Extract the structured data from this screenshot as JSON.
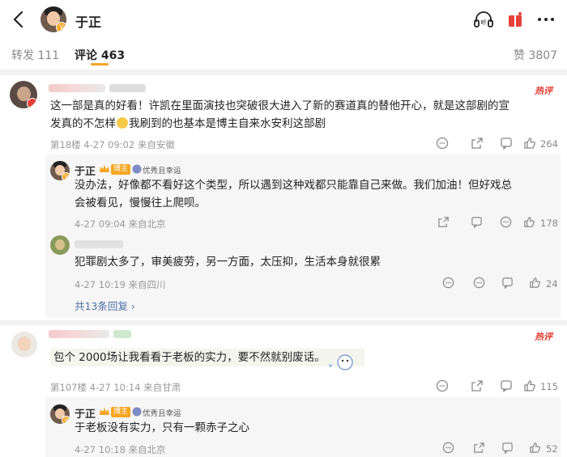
{
  "header": {
    "title": "于正"
  },
  "tabs": [
    {
      "label": "转发 111"
    },
    {
      "label": "评论 463"
    },
    {
      "label": "赞 3807"
    }
  ],
  "comments": [
    {
      "hot_label": "热评",
      "text_line1": "这一部是真的好看！许凯在里面演技也突破很大进入了新的赛道真的替他开心，就是这部剧的宣",
      "text_line2a": "发真的不怎样",
      "text_line2b": "我刷到的也基本是博主自来水安利这部剧",
      "meta": "第18楼  4-27 09:02  来自安徽",
      "likes": "264",
      "replies": [
        {
          "name": "于正",
          "badge": "博主",
          "tag": "优秀且幸运",
          "text_line1": "没办法，好像都不看好这个类型，所以遇到这种戏都只能靠自己来做。我们加油！但好戏总",
          "text_line2": "会被看见，慢慢往上爬呗。",
          "meta": "4-27 09:04  来自北京",
          "likes": "178"
        },
        {
          "text": "犯罪剧太多了，审美疲劳，另一方面，太压抑，生活本身就很累",
          "meta": "4-27 10:19  来自四川",
          "likes": "24"
        }
      ],
      "more_replies": "共13条回复"
    },
    {
      "hot_label": "热评",
      "text": "包个 2000场让我看看于老板的实力，要不然就别废话。",
      "meta": "第107楼  4-27 10:14  来自甘肃",
      "likes": "115",
      "replies": [
        {
          "name": "于正",
          "badge": "博主",
          "tag": "优秀且幸运",
          "text": "于老板没有实力，只有一颗赤子之心",
          "meta": "4-27 10:18  来自北京",
          "likes": "52"
        }
      ]
    }
  ],
  "colors": {
    "accent": "#f5a623",
    "hot": "#e53a2c",
    "link": "#4a6fa5"
  }
}
